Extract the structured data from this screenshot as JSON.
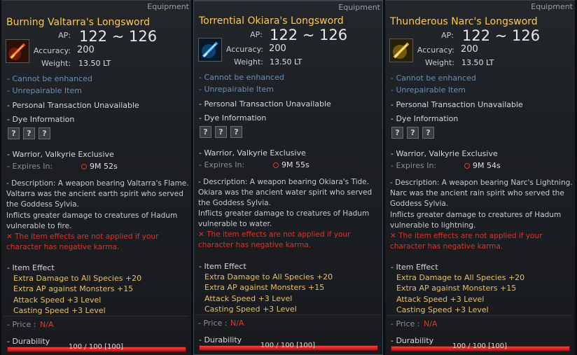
{
  "panels": [
    {
      "category": "Equipment",
      "name": "Burning Valtarra's Longsword",
      "icon": "flame-sword-icon",
      "icon_color": "#d04020",
      "ap_label": "AP:",
      "ap_value": "122 ~ 126",
      "accuracy_label": "Accuracy:",
      "accuracy_value": "200",
      "weight_label": "Weight:",
      "weight_value": "13.50 LT",
      "cannot_enhance": "- Cannot be enhanced",
      "unrepairable": "- Unrepairable Item",
      "personal_transaction": "- Personal Transaction Unavailable",
      "dye_info": "- Dye Information",
      "dye_slots": [
        "?",
        "?",
        "?"
      ],
      "exclusive": "- Warrior, Valkyrie Exclusive",
      "expires_label": "- Expires In:",
      "expires_value": "9M 52s",
      "description": "- Description: A weapon bearing Valtarra's Flame. Valtarra was the ancient earth spirit who served the Goddess Sylvia.",
      "inflicts": "Inflicts greater damage to creatures of Hadum vulnerable to fire.",
      "warning": "✕ The item effects are not applied if your character has negative karma.",
      "item_effect_label": "- Item Effect",
      "effects": [
        "Extra Damage to All Species +20",
        "Extra AP against Monsters +15",
        "Attack Speed +3 Level",
        "Casting Speed +3 Level"
      ],
      "price_label": "- Price :",
      "price_value": "N/A",
      "durability_label": "- Durability",
      "durability_value": "100 / 100  [100]",
      "durability_fraction": 1.0
    },
    {
      "category": "Equipment",
      "name": "Torrential Okiara's Longsword",
      "icon": "water-sword-icon",
      "icon_color": "#2080d0",
      "ap_label": "AP:",
      "ap_value": "122 ~ 126",
      "accuracy_label": "Accuracy:",
      "accuracy_value": "200",
      "weight_label": "Weight:",
      "weight_value": "13.50 LT",
      "cannot_enhance": "- Cannot be enhanced",
      "unrepairable": "- Unrepairable Item",
      "personal_transaction": "- Personal Transaction Unavailable",
      "dye_info": "- Dye Information",
      "dye_slots": [
        "?",
        "?",
        "?"
      ],
      "exclusive": "- Warrior, Valkyrie Exclusive",
      "expires_label": "- Expires In:",
      "expires_value": "9M 55s",
      "description": "- Description: A weapon bearing Okiara's Tide. Okiara was the ancient water spirit who served the Goddess Sylvia.",
      "inflicts": "Inflicts greater damage to creatures of Hadum vulnerable to water.",
      "warning": "✕ The item effects are not applied if your character has negative karma.",
      "item_effect_label": "- Item Effect",
      "effects": [
        "Extra Damage to All Species +20",
        "Extra AP against Monsters +15",
        "Attack Speed +3 Level",
        "Casting Speed +3 Level"
      ],
      "price_label": "- Price :",
      "price_value": "N/A",
      "durability_label": "- Durability",
      "durability_value": "100 / 100  [100]",
      "durability_fraction": 1.0
    },
    {
      "category": "Equipment",
      "name": "Thunderous Narc's Longsword",
      "icon": "lightning-sword-icon",
      "icon_color": "#d0a020",
      "ap_label": "AP:",
      "ap_value": "122 ~ 126",
      "accuracy_label": "Accuracy:",
      "accuracy_value": "200",
      "weight_label": "Weight:",
      "weight_value": "13.50 LT",
      "cannot_enhance": "- Cannot be enhanced",
      "unrepairable": "- Unrepairable Item",
      "personal_transaction": "- Personal Transaction Unavailable",
      "dye_info": "- Dye Information",
      "dye_slots": [
        "?",
        "?",
        "?"
      ],
      "exclusive": "- Warrior, Valkyrie Exclusive",
      "expires_label": "- Expires In:",
      "expires_value": "9M 54s",
      "description": "- Description: A weapon bearing Narc's Lightning. Narc was the ancient rain spirit who served the Goddess Sylvia.",
      "inflicts": "Inflicts greater damage to creatures of Hadum vulnerable to lightning.",
      "warning": "✕ The item effects are not applied if your character has negative karma.",
      "item_effect_label": "- Item Effect",
      "effects": [
        "Extra Damage to All Species +20",
        "Extra AP against Monsters +15",
        "Attack Speed +3 Level",
        "Casting Speed +3 Level"
      ],
      "price_label": "- Price :",
      "price_value": "N/A",
      "durability_label": "- Durability",
      "durability_value": "100 / 100  [100]",
      "durability_fraction": 1.0
    }
  ]
}
